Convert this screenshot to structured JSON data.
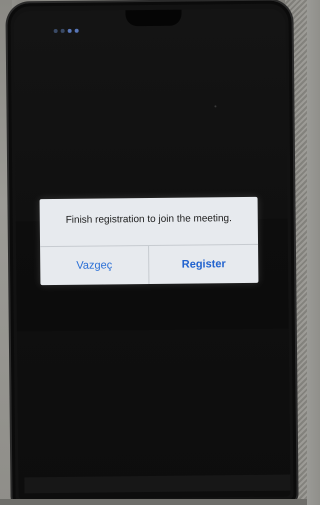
{
  "dialog": {
    "message": "Finish registration to join the meeting.",
    "cancel_label": "Vazgeç",
    "register_label": "Register"
  },
  "colors": {
    "accent": "#2a6fd6",
    "dialog_bg": "#e7eaee"
  }
}
